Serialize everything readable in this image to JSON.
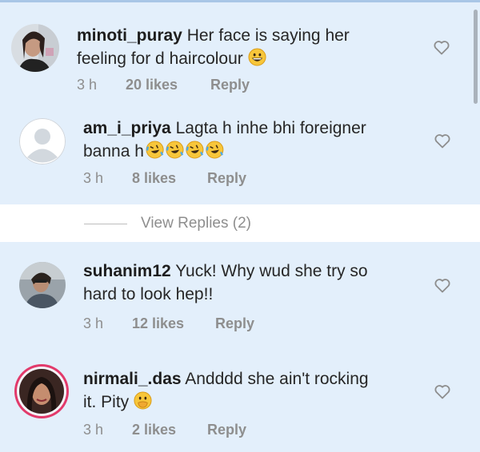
{
  "comments": [
    {
      "username": "minoti_puray",
      "text": "Her face is saying her feeling for d haircolour",
      "text_line1": "Her face is saying her",
      "text_line2": "feeling for d haircolour",
      "emoji": "grinning-face",
      "time": "3 h",
      "likes": "20 likes",
      "reply": "Reply"
    },
    {
      "username": "am_i_priya",
      "text_line1": "Lagta h inhe bhi foreigner",
      "text_line2": "banna h",
      "emoji": "rolling-on-floor-laughing x4",
      "time": "3 h",
      "likes": "8 likes",
      "reply": "Reply"
    },
    {
      "username": "suhanim12",
      "text_line1": "Yuck! Why wud she try so",
      "text_line2": "hard to look hep!!",
      "time": "3 h",
      "likes": "12 likes",
      "reply": "Reply"
    },
    {
      "username": "nirmali_.das",
      "text_line1": "Andddd she ain't rocking",
      "text_line2": "it. Pity",
      "emoji": "hand-over-mouth",
      "time": "3 h",
      "likes": "2 likes",
      "reply": "Reply"
    }
  ],
  "view_replies": "View Replies (2)",
  "colors": {
    "comment_bg": "#e3effb",
    "meta_text": "#8e8e8e",
    "story_ring": "#e23a6b"
  },
  "icons": [
    "heart-outline-icon",
    "avatar-placeholder-icon"
  ]
}
